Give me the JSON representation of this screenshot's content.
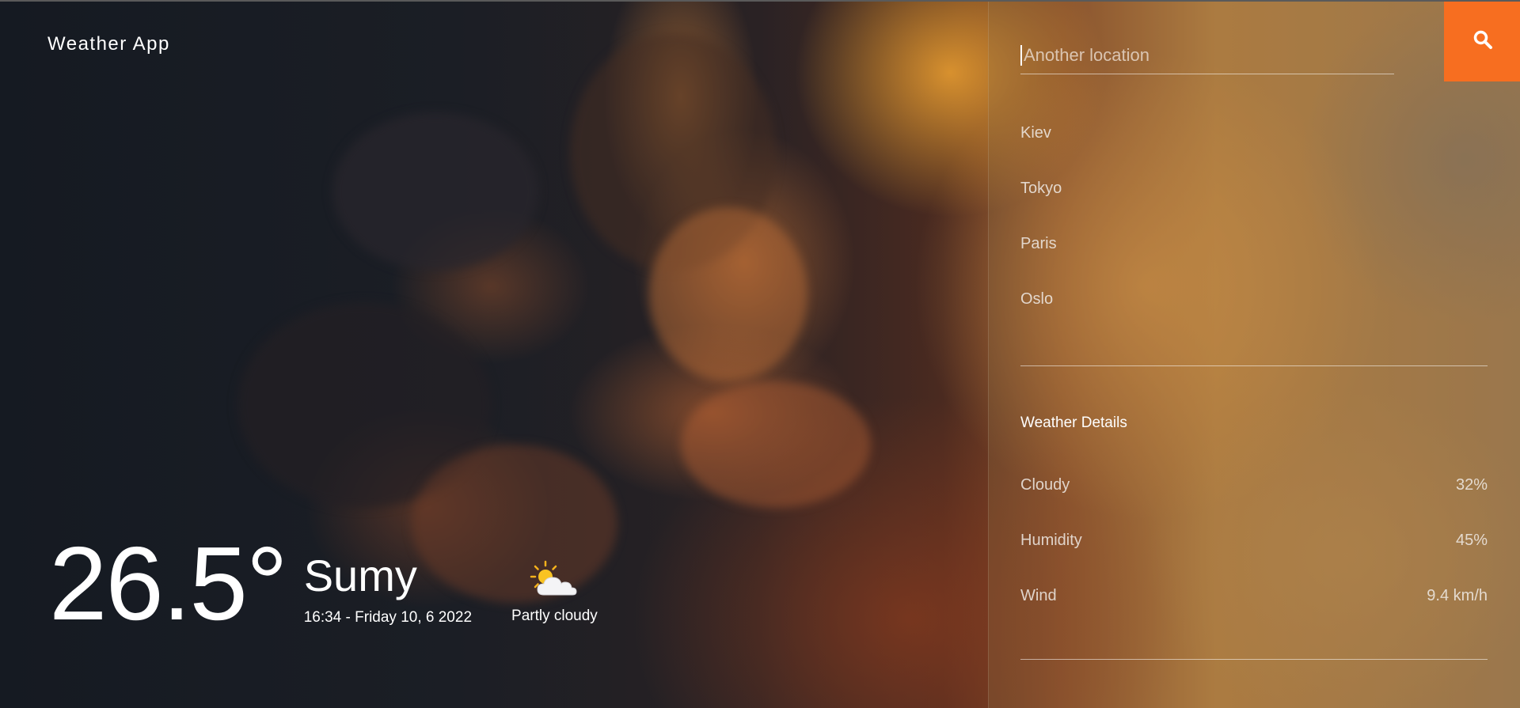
{
  "app": {
    "brand": "Weather App"
  },
  "current": {
    "temperature": "26.5°",
    "city": "Sumy",
    "datetime": "16:34 - Friday 10, 6 2022",
    "condition": "Partly cloudy",
    "condition_icon": "partly-cloudy-icon"
  },
  "search": {
    "placeholder": "Another location",
    "value": "",
    "button_icon": "search-icon"
  },
  "locations": [
    "Kiev",
    "Tokyo",
    "Paris",
    "Oslo"
  ],
  "details": {
    "title": "Weather Details",
    "rows": [
      {
        "label": "Cloudy",
        "value": "32%"
      },
      {
        "label": "Humidity",
        "value": "45%"
      },
      {
        "label": "Wind",
        "value": "9.4 km/h"
      }
    ]
  },
  "colors": {
    "accent": "#f76e20",
    "text": "#ffffff"
  }
}
